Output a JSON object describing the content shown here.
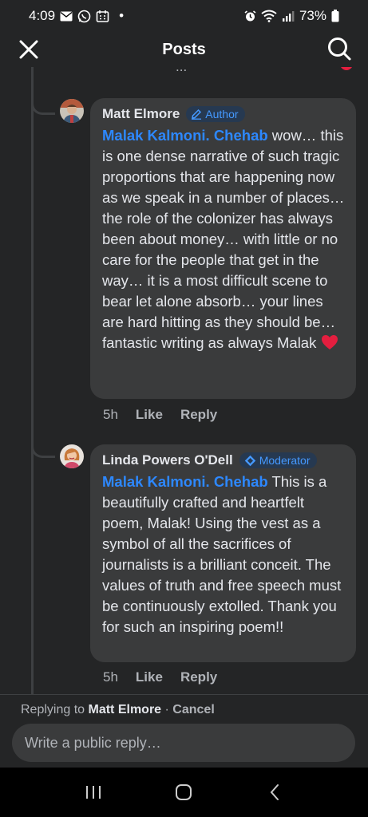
{
  "status_bar": {
    "time": "4:09",
    "dot": "•",
    "battery_percent": "73%",
    "notification_icons": [
      "mail-icon",
      "whatsapp-icon",
      "calendar-icon"
    ],
    "system_icons": [
      "alarm-icon",
      "wifi-icon",
      "signal-icon",
      "battery-icon"
    ]
  },
  "header": {
    "title": "Posts"
  },
  "thread": {
    "partial_text": "...",
    "comments": [
      {
        "author": "Matt Elmore",
        "badge": "Author",
        "mention": "Malak Kalmoni. Chehab",
        "text": " wow… this is one dense narrative of such tragic proportions that are happening now as we speak in a number of places… the role of the colonizer has always been about money… with little or no care for the people that get in the way… it is a most difficult scene to bear let alone absorb… your lines are hard hitting as they should be… fantastic writing as always Malak",
        "emoji": "❤️",
        "time": "5h",
        "like_label": "Like",
        "reply_label": "Reply"
      },
      {
        "author": "Linda Powers O'Dell",
        "badge": "Moderator",
        "mention": "Malak Kalmoni. Chehab",
        "text": " This is a beautifully crafted and heartfelt poem, Malak! Using the vest as a symbol of all the sacrifices of journalists is a brilliant conceit. The values of truth and free speech must be continuously extolled. Thank you for such an inspiring poem!!",
        "time": "5h",
        "like_label": "Like",
        "reply_label": "Reply"
      }
    ]
  },
  "reply_bar": {
    "replying_prefix": "Replying to ",
    "replying_name": "Matt Elmore",
    "separator": " · ",
    "cancel_label": "Cancel",
    "placeholder": "Write a public reply…"
  },
  "colors": {
    "background": "#242526",
    "bubble": "#3a3b3c",
    "mention": "#2d88ff",
    "badge_text": "#4599ff",
    "heart": "#e41e3f"
  }
}
